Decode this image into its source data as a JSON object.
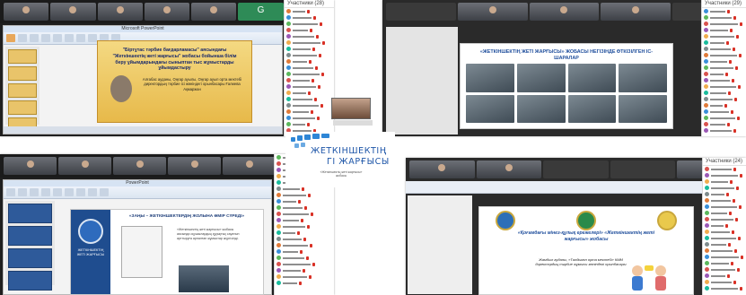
{
  "center_logo": {
    "line1": "ЖЕТКІНШЕКТІҢ",
    "line2": "ГІ ЖАРҒЫСЫ",
    "subtitle": "«Жеткіншектің жеті жарғысы» жобасы"
  },
  "panel_top_left": {
    "window_title": "Microsoft PowerPoint",
    "slide_title": "\"Біртұтас тәрбие бағдарламасы\" аясындағы \"Жеткіншектің жеті жарғысы\" жобасы бойынша білім беру ұйымдарындағы сыныптан тыс жұмыстарды ұйымдастыру",
    "slide_subtitle": "Алғабас ауданы, Оңғар ауылы, Оңғар ауыл орта мектебі директордың тәрбие ісі жөніндегі орынбасары Ғалиева Ақмаржан",
    "participants_header": "Участники (28)"
  },
  "panel_top_right": {
    "slide_title": "«ЖЕТКІНШЕКТІҢ ЖЕТІ ЖАРҒЫСЫ» ЖОБАСЫ НЕГІЗІНДЕ ӨТКІЗІЛГЕН ІС-ШАРАЛАР",
    "participants_header": "Участники (29)"
  },
  "panel_bottom_left": {
    "window_title": "PowerPoint",
    "slide_title": "«ЗАҢЫ – ЖЕТКІНШЕКТЕРДІҢ ЖОЛЫНА ӨМІР СҮРЕДІ»",
    "logo_text": "ЖЕТКІНШЕКТІҢ ЖЕТІ ЖАРҒЫСЫ",
    "body_text": "«Жеткіншектің жеті жарғысы» жобасы аясында оқушылардың құқықтық сауатын арттыруға арналған жұмыстар жүргізілді."
  },
  "panel_bottom_right": {
    "slide_title": "«Қоғамдағы мінез-құлық ережелері» «Жеткіншектің жеті жарғысы» жобасы",
    "slide_subtitle": "Жамбыл ауданы, «Талдыкөл орта мектебі» КММ директордың тәрбие жұмысы жөніндегі орынбасары",
    "participants_header": "Участники (24)"
  },
  "colors": {
    "brand_blue": "#1e56a8",
    "slide_gold": "#e7b94a",
    "mic_off": "#d93025"
  }
}
